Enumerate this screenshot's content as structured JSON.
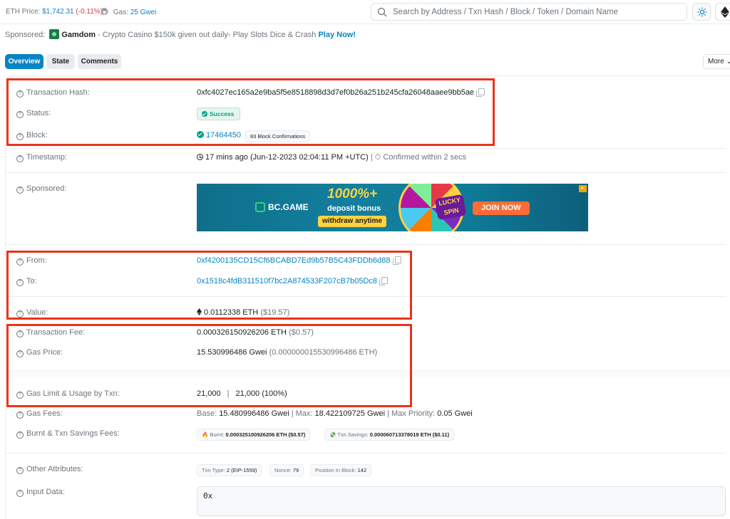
{
  "topbar": {
    "eth_price_label": "ETH Price:",
    "eth_price_value": "$1,742.31",
    "eth_price_change": "(-0.11%)",
    "gas_label": "Gas:",
    "gas_value": "25 Gwei",
    "search_placeholder": "Search by Address / Txn Hash / Block / Token / Domain Name"
  },
  "sponsored": {
    "label": "Sponsored:",
    "brand": "Gamdom",
    "text": " - Crypto Casino $150k given out daily- Play Slots Dice & Crash ",
    "cta": "Play Now!"
  },
  "tabs": [
    {
      "label": "Overview",
      "active": true
    },
    {
      "label": "State",
      "active": false
    },
    {
      "label": "Comments",
      "active": false
    }
  ],
  "more_label": "More",
  "tx": {
    "hash_label": "Transaction Hash:",
    "hash_value": "0xfc4027ec165a2e9ba5f5e8518898d3d7ef0b26a251b245cfa26048aaee9bb5ae",
    "status_label": "Status:",
    "status_value": "Success",
    "block_label": "Block:",
    "block_value": "17464450",
    "block_confirmations": "83 Block Confirmations",
    "timestamp_label": "Timestamp:",
    "timestamp_value": "17 mins ago (Jun-12-2023 02:04:11 PM +UTC)",
    "timestamp_sep": " | ",
    "confirmed_within": "Confirmed within 2 secs",
    "sponsored_label": "Sponsored:",
    "from_label": "From:",
    "from_value": "0xf4200135CD15Cf6BCABD7Ed9b57B5C43FDDb6d88",
    "to_label": "To:",
    "to_value": "0x1518c4fdB311510f7bc2A874533F207cB7b05Dc8",
    "value_label": "Value:",
    "value_eth": "0.0112338 ETH",
    "value_usd": "($19.57)",
    "fee_label": "Transaction Fee:",
    "fee_eth": "0.000326150926206 ETH",
    "fee_usd": "($0.57)",
    "gas_price_label": "Gas Price:",
    "gas_price_gwei": "15.530996486 Gwei",
    "gas_price_eth": "(0.000000015530996486 ETH)",
    "gas_limit_label": "Gas Limit & Usage by Txn:",
    "gas_limit": "21,000",
    "gas_usage": "21,000 (100%)",
    "gas_fees_label": "Gas Fees:",
    "gas_fees_base_label": "Base: ",
    "gas_fees_base": "15.480996486 Gwei",
    "gas_fees_max_label": "Max: ",
    "gas_fees_max": "18.422109725 Gwei",
    "gas_fees_maxprio_label": "Max Priority: ",
    "gas_fees_maxprio": "0.05 Gwei",
    "burnt_label": "Burnt & Txn Savings Fees:",
    "burnt_prefix": "Burnt: ",
    "burnt_value": "0.000325100926206 ETH ($0.57)",
    "savings_prefix": "Txn Savings: ",
    "savings_value": "0.000060713378019 ETH ($0.11)",
    "other_label": "Other Attributes:",
    "txn_type_label": "Txn Type: ",
    "txn_type_value": "2 (EIP-1559)",
    "nonce_label": "Nonce: ",
    "nonce_value": "79",
    "position_label": "Position In Block: ",
    "position_value": "142",
    "input_label": "Input Data:",
    "input_value": "0x"
  },
  "ad": {
    "brand": "BC.GAME",
    "headline": "1000%+",
    "sub": "deposit bonus",
    "pill": "withdraw anytime",
    "lucky": "LUCKY SPIN",
    "cta": "JOIN NOW"
  },
  "colors": {
    "accent": "#0784c3",
    "success": "#00a186",
    "highlight": "#e8341c",
    "negative": "#dc3545"
  }
}
